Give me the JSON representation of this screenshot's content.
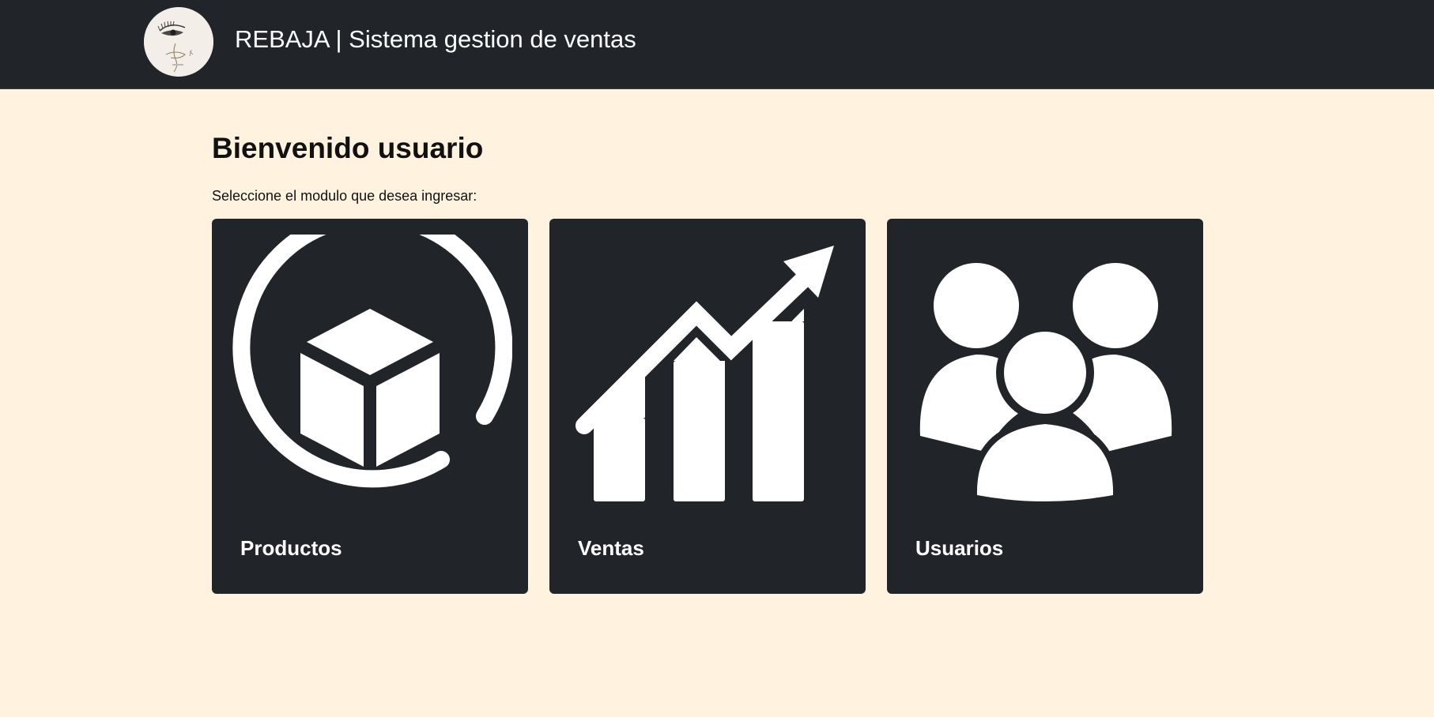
{
  "header": {
    "logo_icon": "eye-sketch-logo",
    "brand_title": "REBAJA | Sistema gestion de ventas",
    "background_color": "#212529"
  },
  "main": {
    "title": "Bienvenido usuario",
    "subtitle": "Seleccione el modulo que desea ingresar:",
    "background_color": "#fff3df",
    "modules": [
      {
        "label": "Productos",
        "icon": "box-icon"
      },
      {
        "label": "Ventas",
        "icon": "growth-chart-icon"
      },
      {
        "label": "Usuarios",
        "icon": "users-group-icon"
      }
    ]
  }
}
